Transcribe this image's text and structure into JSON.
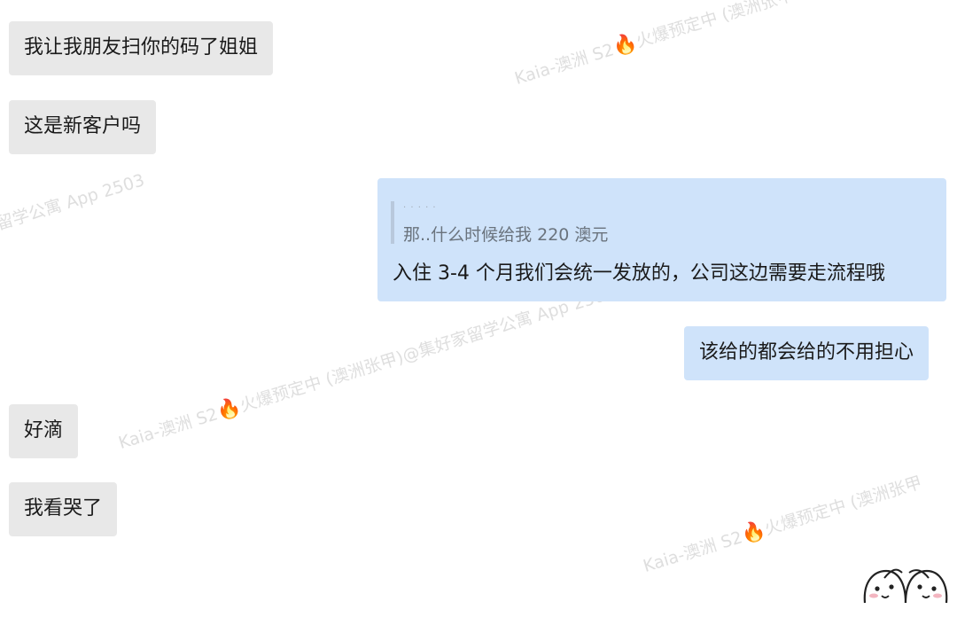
{
  "messages": [
    {
      "side": "left",
      "text": "我让我朋友扫你的码了姐姐"
    },
    {
      "side": "left",
      "text": "这是新客户吗"
    },
    {
      "side": "right",
      "quote": "那..什么时候给我 220 澳元",
      "quote_ghost": "· ·  ·  ·  ·",
      "text": "入住 3-4 个月我们会统一发放的，公司这边需要走流程哦"
    },
    {
      "side": "right",
      "text": "该给的都会给的不用担心"
    },
    {
      "side": "left",
      "text": "好滴"
    },
    {
      "side": "left",
      "text": "我看哭了"
    }
  ],
  "watermarks": {
    "w1": "Kaia-澳洲 S2",
    "w1b": "火爆预定中 (澳洲张甲",
    "w2": "留学公寓 App 2503",
    "w3": "Kaia-澳洲 S2",
    "w3b": "火爆预定中 (澳洲张甲)@集好家留学公寓 App 2503",
    "w4": "Kaia-澳洲 S2",
    "w4b": "火爆预定中 (澳洲张甲"
  },
  "icons": {
    "fire": "fire-emoji",
    "sticker": "two-faces-sticker"
  },
  "colors": {
    "incoming_bubble": "#e8e8e8",
    "outgoing_bubble": "#cfe3fa",
    "quote_bar": "#b8c8dc"
  }
}
